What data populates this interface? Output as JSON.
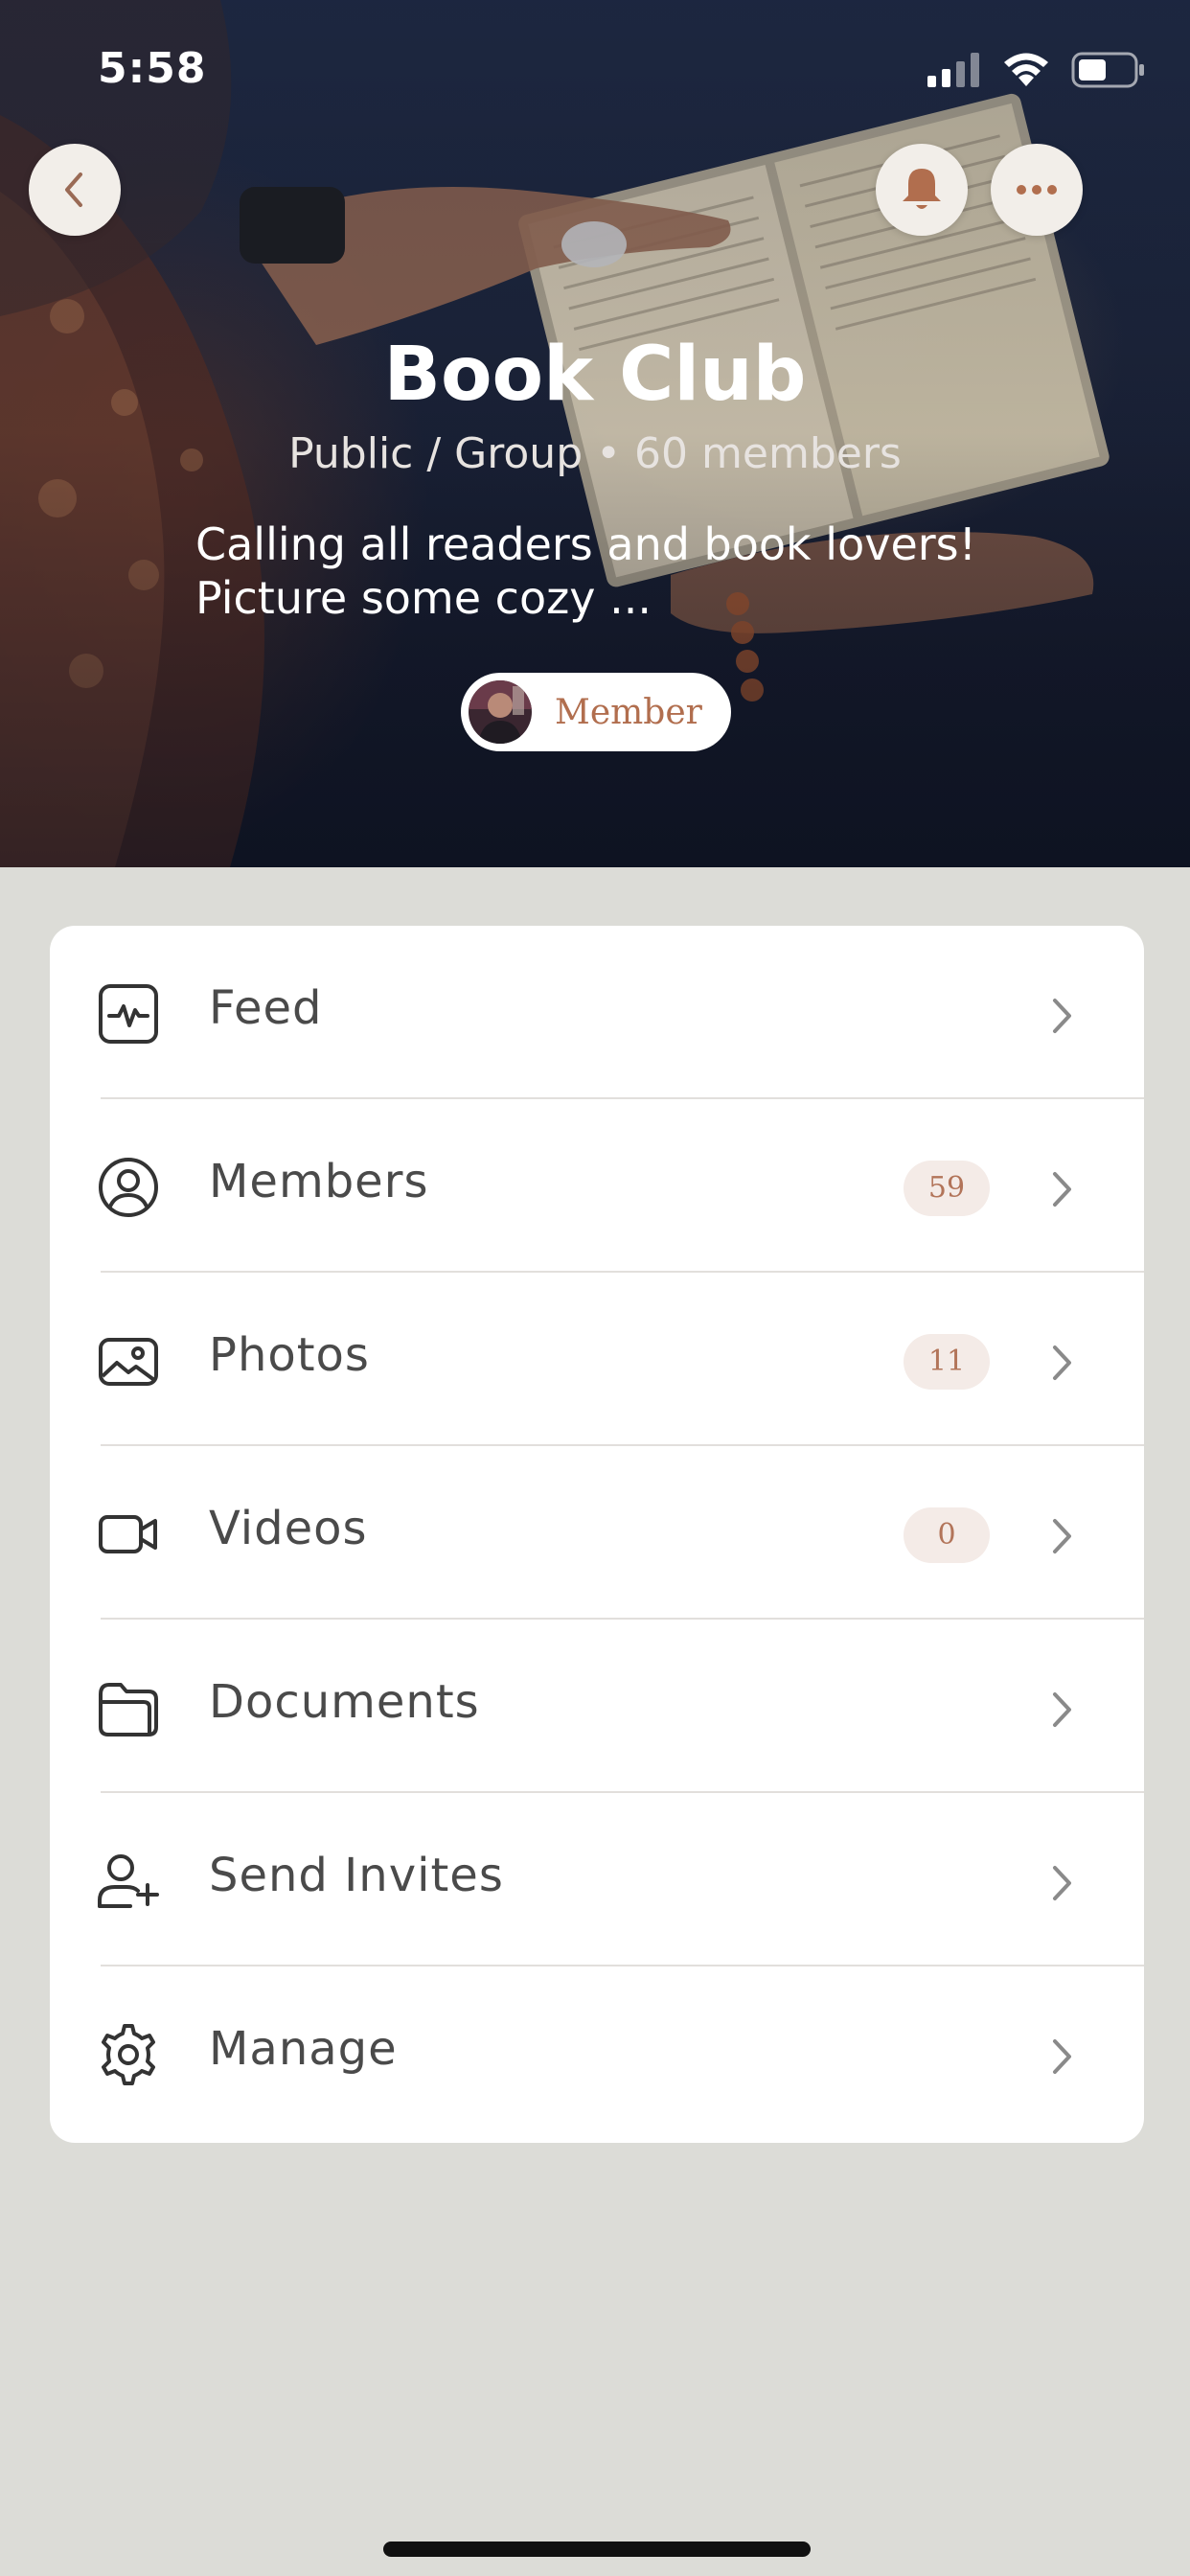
{
  "status_bar": {
    "time": "5:58"
  },
  "group": {
    "title": "Book Club",
    "meta": "Public / Group • 60 members",
    "description": "Calling all readers and book lovers! Picture some cozy ...",
    "membership_label": "Member"
  },
  "menu": {
    "items": [
      {
        "label": "Feed",
        "icon": "activity-icon",
        "badge": null
      },
      {
        "label": "Members",
        "icon": "user-circle-icon",
        "badge": "59"
      },
      {
        "label": "Photos",
        "icon": "image-icon",
        "badge": "11"
      },
      {
        "label": "Videos",
        "icon": "video-camera-icon",
        "badge": "0"
      },
      {
        "label": "Documents",
        "icon": "folder-icon",
        "badge": null
      },
      {
        "label": "Send Invites",
        "icon": "user-plus-icon",
        "badge": null
      },
      {
        "label": "Manage",
        "icon": "gear-icon",
        "badge": null
      }
    ]
  },
  "colors": {
    "accent": "#b16e4e",
    "badge_bg": "#f4ebe7",
    "page_bg": "#dcdcd7",
    "hero_bg": "#1b2338"
  }
}
